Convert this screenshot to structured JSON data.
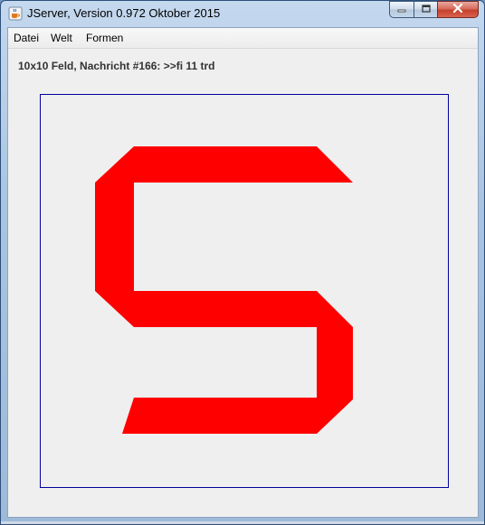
{
  "window": {
    "title": "JServer, Version 0.972 Oktober 2015"
  },
  "icons": {
    "app": "java-coffee-cup-icon",
    "minimize": "minimize-icon",
    "maximize": "maximize-icon",
    "close": "close-icon"
  },
  "menu": {
    "items": [
      {
        "label": "Datei"
      },
      {
        "label": "Welt"
      },
      {
        "label": "Formen"
      }
    ]
  },
  "status": {
    "message": "10x10 Feld, Nachricht #166: >>fi 11 trd"
  },
  "board": {
    "shape_color": "#ff0000",
    "frame_color": "#0000a0",
    "background": "#efefef"
  }
}
